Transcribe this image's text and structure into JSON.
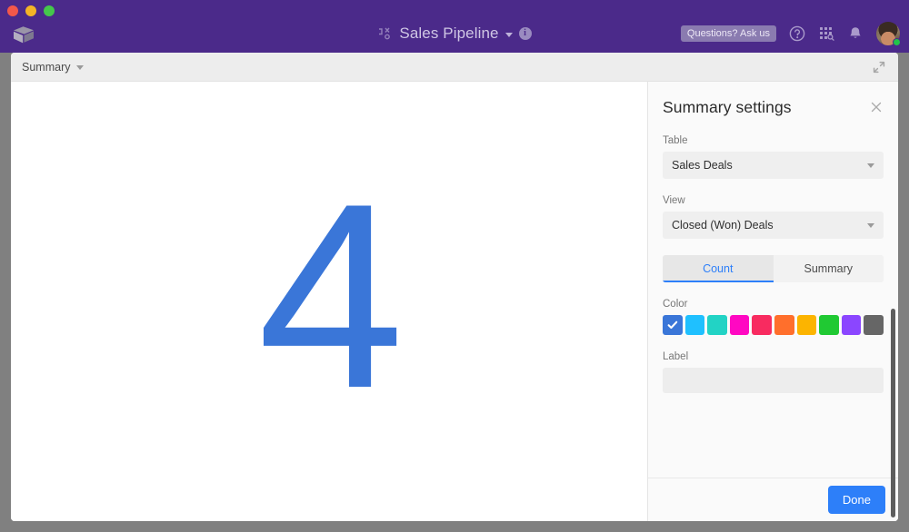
{
  "window": {
    "traffic_lights": [
      "close",
      "minimize",
      "maximize"
    ]
  },
  "header": {
    "logo_name": "airtable-cube-logo",
    "base_icon_name": "base-glyph-icon",
    "title": "Sales Pipeline",
    "title_caret_name": "chevron-down-icon",
    "info_icon_glyph": "i",
    "ask_us_label": "Questions? Ask us",
    "help_icon_name": "help-circle-icon",
    "apps_icon_name": "apps-grid-search-icon",
    "bell_icon_name": "notification-bell-icon",
    "avatar_name": "user-avatar",
    "status": "online",
    "colors": {
      "header_bg": "#4B2A8A",
      "title_text": "#CFC6E4",
      "ask_us_bg": "#8A7BB0",
      "status_dot": "#21C44A"
    }
  },
  "toolbar": {
    "view_name": "Summary",
    "caret_name": "chevron-down-icon",
    "expand_icon_name": "expand-fullscreen-icon"
  },
  "summary": {
    "value": "4",
    "value_color": "#3A76D8"
  },
  "settings": {
    "title": "Summary settings",
    "close_icon_name": "close-icon",
    "table": {
      "label": "Table",
      "value": "Sales Deals"
    },
    "view": {
      "label": "View",
      "value": "Closed (Won) Deals"
    },
    "tabs": [
      {
        "label": "Count",
        "active": true
      },
      {
        "label": "Summary",
        "active": false
      }
    ],
    "color": {
      "label": "Color",
      "selected_index": 0,
      "swatches": [
        {
          "name": "blue",
          "hex": "#3A76D8"
        },
        {
          "name": "cyan",
          "hex": "#1FC0FF"
        },
        {
          "name": "teal",
          "hex": "#22D3C5"
        },
        {
          "name": "magenta",
          "hex": "#FF08C2"
        },
        {
          "name": "red",
          "hex": "#F82B60"
        },
        {
          "name": "orange",
          "hex": "#FF6F2C"
        },
        {
          "name": "amber",
          "hex": "#FCB400"
        },
        {
          "name": "green",
          "hex": "#20C933"
        },
        {
          "name": "purple",
          "hex": "#8B46FF"
        },
        {
          "name": "gray",
          "hex": "#666666"
        }
      ]
    },
    "label_field": {
      "label": "Label",
      "value": "",
      "placeholder": ""
    },
    "done_label": "Done",
    "accent_color": "#2D7FF9"
  }
}
